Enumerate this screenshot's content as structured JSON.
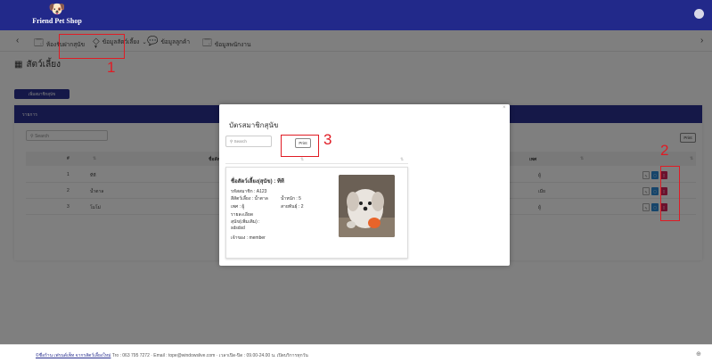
{
  "app": {
    "logo_text": "Friend Pet Shop",
    "logo_glyph": "🐶"
  },
  "menu": {
    "items": [
      {
        "label": "ห้องรับฝากสุนัข",
        "icon": "🗔"
      },
      {
        "label": "ข้อมูลสัตว์เลี้ยง",
        "icon": "◇"
      },
      {
        "label": "ข้อมูลลูกค้า",
        "icon": "💬"
      },
      {
        "label": "ข้อมูลพนักงาน",
        "icon": "🗔"
      }
    ],
    "dropdown_indicator": "⌄",
    "caret": "▼"
  },
  "page": {
    "title": "สัตว์เลี้ยง",
    "add_button": "เพิ่มสมาชิกสุนัข"
  },
  "list": {
    "header": "รายการ",
    "search_placeholder": "Search",
    "print_label": "Print",
    "columns": [
      "#",
      "ชื่อสัตว์เลี้ยง",
      "เพศ"
    ],
    "rows": [
      {
        "no": "1",
        "name": "ทีที",
        "gender": "ผู้"
      },
      {
        "no": "2",
        "name": "น้ำตาล",
        "gender": "เมีย"
      },
      {
        "no": "3",
        "name": "โมโม่",
        "gender": "ผู้"
      }
    ]
  },
  "modal": {
    "title": "บัตรสมาชิกสุนัข",
    "search_placeholder": "Search",
    "print_label": "Print",
    "close": "×",
    "card": {
      "name_line": "ชื่อสัตว์เลี้ยง(สุนัข) : ทีที",
      "member_id": "รหัสสมาชิก : A123",
      "color": "สีสัตว์เลี้ยง : น้ำตาล",
      "weight": "น้ำหนัก : 5",
      "gender": "เพศ : ผู้",
      "breed": "สายพันธุ์ : 2",
      "detail_label_1": "รายละเอียด",
      "detail_label_2": "สุนัข(เพิ่มเติม) :",
      "detail_value": "sdsdsd",
      "owner": "เจ้าของ : member"
    }
  },
  "annotations": [
    "1",
    "2",
    "3"
  ],
  "footer": {
    "brand": "©ชื่อร้าน เฟรนด์เพ็ท จากรสัตว์เลี้ยงใหม่",
    "contact": "Tro : 063 795 7272 · Email : tope@windowslive.com · เวลาเปิด-ปิด : 09.00-24.00 น. เปิดบริการทุกวัน",
    "icon": "⊕"
  },
  "colors": {
    "primary": "#2b3190",
    "topbar": "#22298a",
    "annotation": "#e01b24",
    "view_button": "#2c8ad6",
    "delete_button": "#d6235b"
  }
}
